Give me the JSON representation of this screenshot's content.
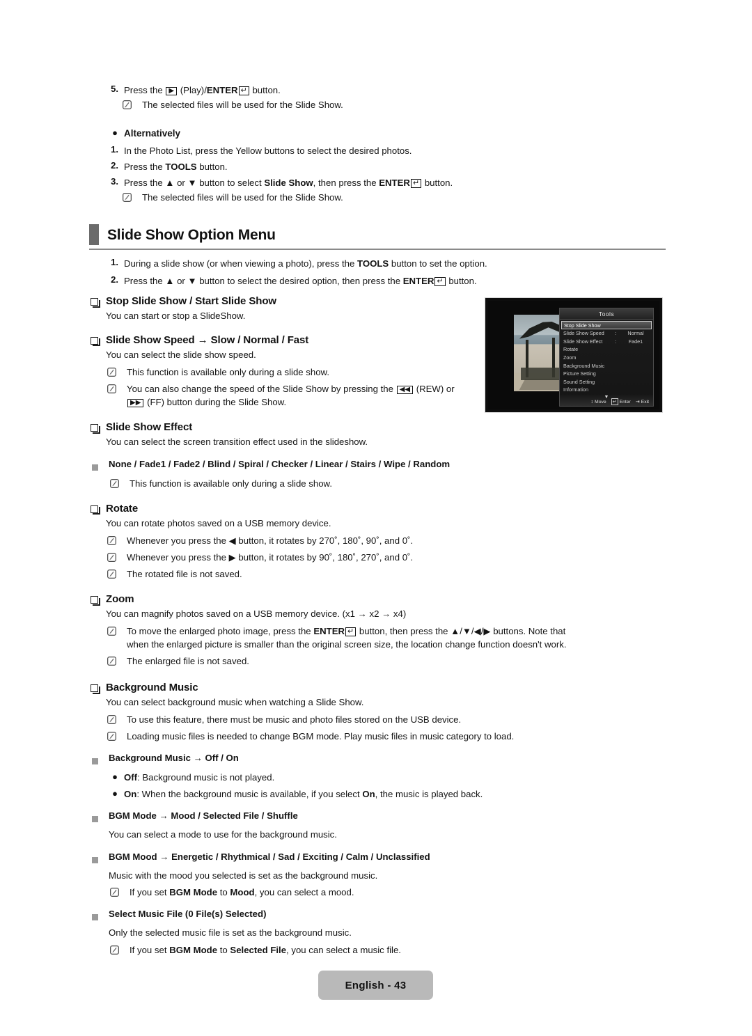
{
  "steps_top": [
    {
      "num": "5.",
      "html": "Press the [PLAY] (Play)/<b>ENTER</b>[ENTER] button."
    }
  ],
  "top": {
    "step5_num": "5.",
    "step5_pre": "Press the",
    "step5_mid": "(Play)/",
    "step5_enter": "ENTER",
    "step5_post": "button.",
    "note1": "The selected files will be used for the Slide Show.",
    "alt_bullet": "●",
    "alt_label": "Alternatively",
    "alt_steps": [
      {
        "num": "1.",
        "text": "In the Photo List, press the Yellow buttons to select the desired photos."
      },
      {
        "num": "2.",
        "pre": "Press the",
        "bold": "TOOLS",
        "post": "button."
      },
      {
        "num": "3.",
        "pre": "Press the ▲ or ▼ button to select",
        "bold": "Slide Show",
        "mid": ", then press the",
        "bold2": "ENTER",
        "post": "button."
      }
    ],
    "note2": "The selected files will be used for the Slide Show."
  },
  "section": {
    "title": "Slide Show Option Menu",
    "steps": [
      {
        "num": "1.",
        "pre": "During a slide show (or when viewing a photo), press the",
        "bold": "TOOLS",
        "post": "button to set the option."
      },
      {
        "num": "2.",
        "pre": "Press the ▲ or ▼ button to select the desired option, then press the",
        "bold": "ENTER",
        "post": "button."
      }
    ]
  },
  "topics": {
    "stop_start": {
      "heading": "Stop Slide Show / Start Slide Show",
      "para": "You can start or stop a SlideShow."
    },
    "speed": {
      "heading": "Slide Show Speed → Slow / Normal / Fast",
      "para": "You can select the slide show speed.",
      "note1": "This function is available only during a slide show.",
      "note2_a": "You can also change the speed of the Slide Show by pressing the",
      "note2_b": "(REW) or",
      "note2_c": "(FF) button during the Slide Show."
    },
    "effect": {
      "heading": "Slide Show Effect",
      "para": "You can select the screen transition effect used in the slideshow.",
      "sub_heading": "None / Fade1 / Fade2 / Blind / Spiral / Checker / Linear / Stairs / Wipe / Random",
      "note1": "This function is available only during a slide show."
    },
    "rotate": {
      "heading": "Rotate",
      "para": "You can rotate photos saved on a USB memory device.",
      "note1": "Whenever you press the ◀ button, it rotates by 270˚, 180˚, 90˚, and 0˚.",
      "note2": "Whenever you press the ▶ button, it rotates by 90˚, 180˚, 270˚, and 0˚.",
      "note3": "The rotated file is not saved."
    },
    "zoom": {
      "heading": "Zoom",
      "para": "You can magnify photos saved on a USB memory device. (x1 → x2 → x4)",
      "note1_a": "To move the enlarged photo image, press the",
      "note1_bold": "ENTER",
      "note1_b": "button, then press the ▲/▼/◀/▶ buttons. Note that when the enlarged picture is smaller than the original screen size, the location change function doesn't work.",
      "note2": "The enlarged file is not saved."
    },
    "bgm": {
      "heading": "Background Music",
      "para": "You can select background music when watching a Slide Show.",
      "note1": "To use this feature, there must be music and photo files stored on the USB device.",
      "note2": "Loading music files is needed to change BGM mode. Play music files in music category to load.",
      "sub1_heading": "Background Music → Off / On",
      "sub1_items": [
        {
          "bullet": "●",
          "bold": "Off",
          "text": ": Background music is not played."
        },
        {
          "bullet": "●",
          "bold": "On",
          "text": ": When the background music is available, if you select ",
          "bold2": "On",
          "text2": ", the music is played back."
        }
      ],
      "sub2_heading": "BGM Mode → Mood / Selected File / Shuffle",
      "sub2_para": "You can select a mode to use for the background music.",
      "sub3_heading": "BGM Mood → Energetic / Rhythmical / Sad / Exciting / Calm / Unclassified",
      "sub3_para": "Music with the mood you selected is set as the background music.",
      "sub3_note_a": "If you set",
      "sub3_note_bold1": "BGM Mode",
      "sub3_note_b": "to",
      "sub3_note_bold2": "Mood",
      "sub3_note_c": ", you can select a mood.",
      "sub4_heading": "Select Music File (0 File(s) Selected)",
      "sub4_para": "Only the selected music file is set as the background music.",
      "sub4_note_a": "If you set",
      "sub4_note_bold1": "BGM Mode",
      "sub4_note_b": "to",
      "sub4_note_bold2": "Selected File",
      "sub4_note_c": ", you can select a music file."
    }
  },
  "tv": {
    "menu_title": "Tools",
    "items": [
      {
        "label": "Stop Slide Show",
        "colon": "",
        "value": "",
        "selected": true
      },
      {
        "label": "Slide Show Speed",
        "colon": ":",
        "value": "Normal",
        "selected": false
      },
      {
        "label": "Slide Show Effect",
        "colon": ":",
        "value": "Fade1",
        "selected": false
      },
      {
        "label": "Rotate",
        "colon": "",
        "value": "",
        "selected": false
      },
      {
        "label": "Zoom",
        "colon": "",
        "value": "",
        "selected": false
      },
      {
        "label": "Background Music",
        "colon": "",
        "value": "",
        "selected": false
      },
      {
        "label": "Picture Setting",
        "colon": "",
        "value": "",
        "selected": false
      },
      {
        "label": "Sound Setting",
        "colon": "",
        "value": "",
        "selected": false
      },
      {
        "label": "Information",
        "colon": "",
        "value": "",
        "selected": false
      }
    ],
    "more_indicator": "▼",
    "footer": {
      "move": "Move",
      "enter": "Enter",
      "exit": "Exit"
    }
  },
  "footer": {
    "page_label": "English - 43"
  },
  "glyphs": {
    "play": "▶",
    "enter_return": "↵",
    "rew": "◀◀",
    "ff": "▶▶",
    "updown": "♦"
  },
  "colors": {
    "heading_bar": "#6b6b6b",
    "rule": "#8a8a8a",
    "sub_bullet": "#9a9a9a",
    "footer_bg": "#b9b9b9"
  }
}
